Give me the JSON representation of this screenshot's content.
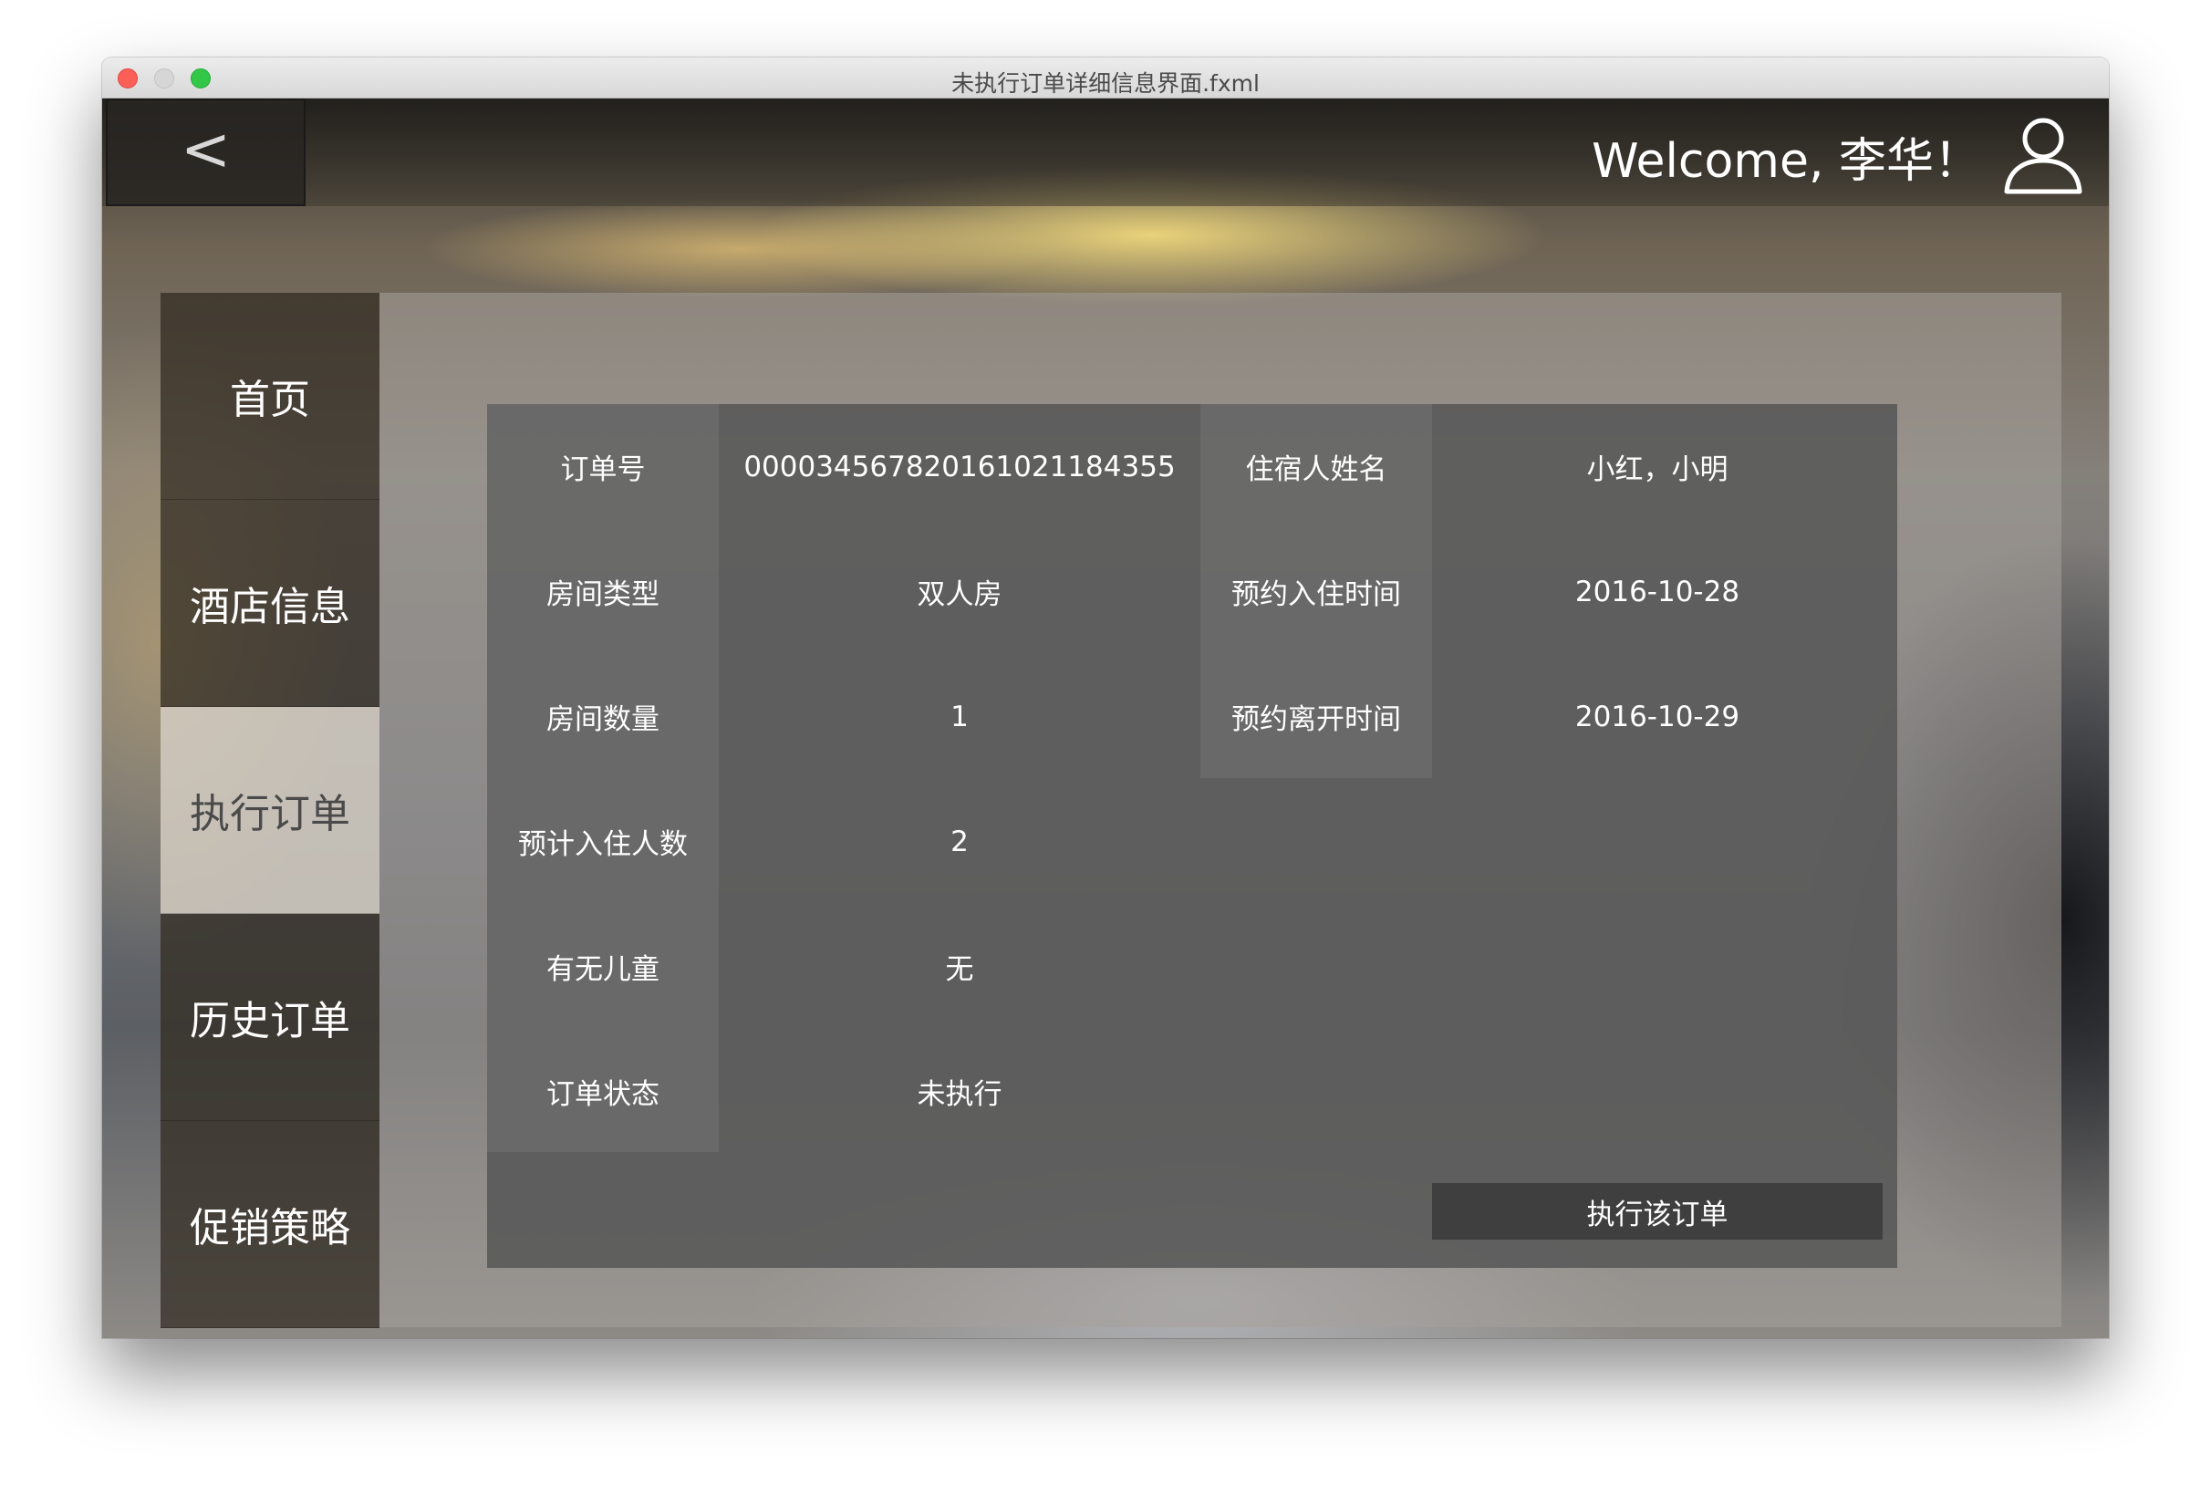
{
  "window": {
    "title": "未执行订单详细信息界面.fxml"
  },
  "header": {
    "back_label": "<",
    "welcome": "Welcome, 李华！",
    "user_icon": "user-icon"
  },
  "sidebar": {
    "items": [
      {
        "label": "首页",
        "active": false
      },
      {
        "label": "酒店信息",
        "active": false
      },
      {
        "label": "执行订单",
        "active": true
      },
      {
        "label": "历史订单",
        "active": false
      },
      {
        "label": "促销策略",
        "active": false
      }
    ]
  },
  "order": {
    "left_rows": [
      {
        "label": "订单号",
        "value": "000034567820161021184355"
      },
      {
        "label": "房间类型",
        "value": "双人房"
      },
      {
        "label": "房间数量",
        "value": "1"
      },
      {
        "label": "预计入住人数",
        "value": "2"
      },
      {
        "label": "有无儿童",
        "value": "无"
      },
      {
        "label": "订单状态",
        "value": "未执行"
      }
    ],
    "right_rows": [
      {
        "label": "住宿人姓名",
        "value": "小红，小明"
      },
      {
        "label": "预约入住时间",
        "value": "2016-10-28"
      },
      {
        "label": "预约离开时间",
        "value": "2016-10-29"
      }
    ],
    "execute_button": "执行该订单"
  }
}
